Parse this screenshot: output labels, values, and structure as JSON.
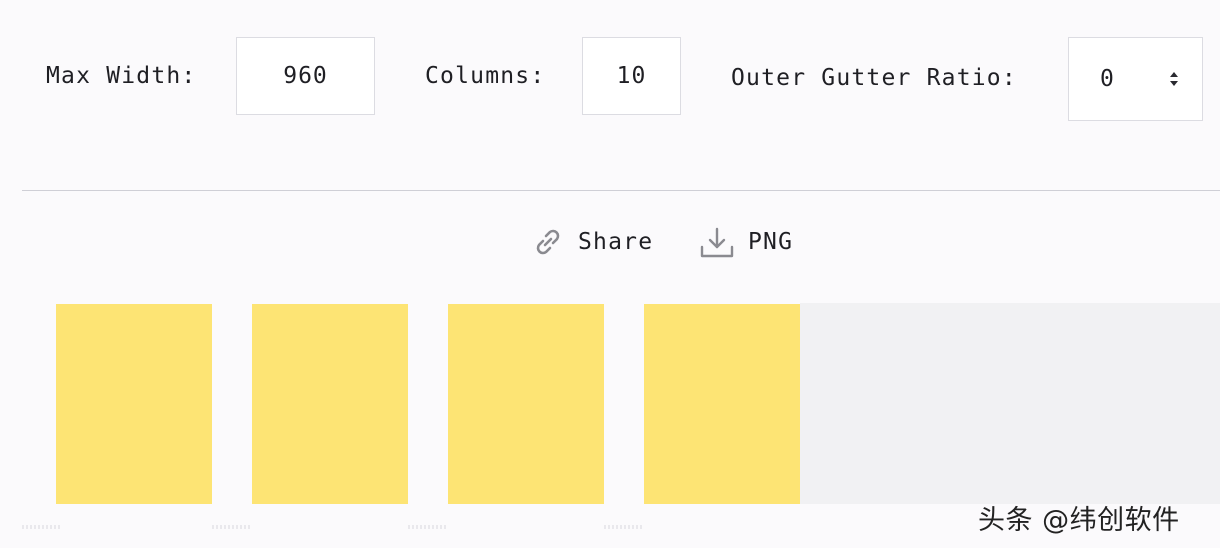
{
  "controls": {
    "max_width": {
      "label": "Max Width:",
      "value": "960"
    },
    "columns": {
      "label": "Columns:",
      "value": "10"
    },
    "outer_gutter_ratio": {
      "label": "Outer Gutter Ratio:",
      "value": "0"
    }
  },
  "actions": {
    "share_label": "Share",
    "png_label": "PNG"
  },
  "grid": {
    "visible_columns": 4,
    "column_color": "#fde474",
    "empty_area_color": "#f1f1f3"
  },
  "watermark": {
    "text": "头条 @纬创软件"
  },
  "icons": {
    "share": "link-icon",
    "png": "download-icon",
    "stepper": "stepper-icon"
  }
}
